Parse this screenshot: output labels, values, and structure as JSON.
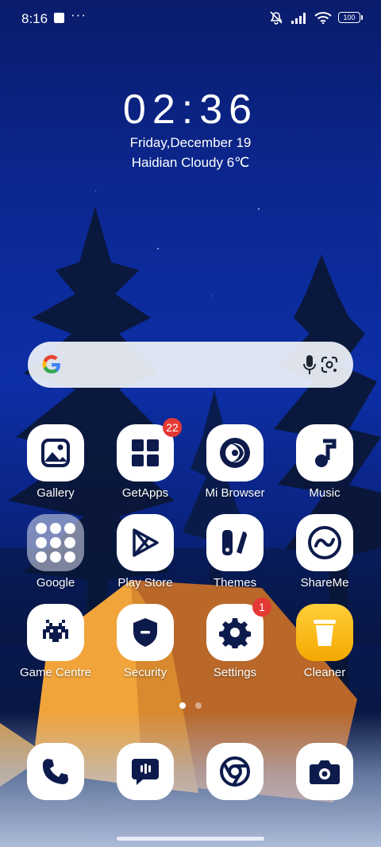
{
  "status_bar": {
    "time": "8:16",
    "battery": "100",
    "icons": [
      "notification-square-icon",
      "more-dots-icon",
      "mute-icon",
      "signal-icon",
      "wifi-icon",
      "battery-icon"
    ]
  },
  "clock_widget": {
    "time": "02:36",
    "date": "Friday,December 19",
    "weather": "Haidian Cloudy 6℃"
  },
  "search_bar": {
    "icons": [
      "google-g-icon",
      "microphone-icon",
      "google-lens-icon"
    ]
  },
  "apps": [
    {
      "label": "Gallery",
      "icon": "gallery-icon"
    },
    {
      "label": "GetApps",
      "icon": "getapps-icon",
      "badge": "22"
    },
    {
      "label": "Mi Browser",
      "icon": "mi-browser-icon"
    },
    {
      "label": "Music",
      "icon": "music-note-icon"
    },
    {
      "label": "Google",
      "icon": "google-folder-icon"
    },
    {
      "label": "Play Store",
      "icon": "play-store-icon"
    },
    {
      "label": "Themes",
      "icon": "themes-icon"
    },
    {
      "label": "ShareMe",
      "icon": "shareme-icon"
    },
    {
      "label": "Game Centre",
      "icon": "game-centre-icon"
    },
    {
      "label": "Security",
      "icon": "security-shield-icon"
    },
    {
      "label": "Settings",
      "icon": "settings-gear-icon",
      "badge": "1"
    },
    {
      "label": "Cleaner",
      "icon": "cleaner-trash-icon"
    }
  ],
  "page_indicator": {
    "pages": 2,
    "current": 1
  },
  "dock": [
    {
      "icon": "phone-icon"
    },
    {
      "icon": "messages-icon"
    },
    {
      "icon": "chrome-icon"
    },
    {
      "icon": "camera-icon"
    }
  ],
  "colors": {
    "icon_glyph": "#0d1b4c",
    "badge": "#e53935",
    "cleaner": "#f4b400"
  }
}
